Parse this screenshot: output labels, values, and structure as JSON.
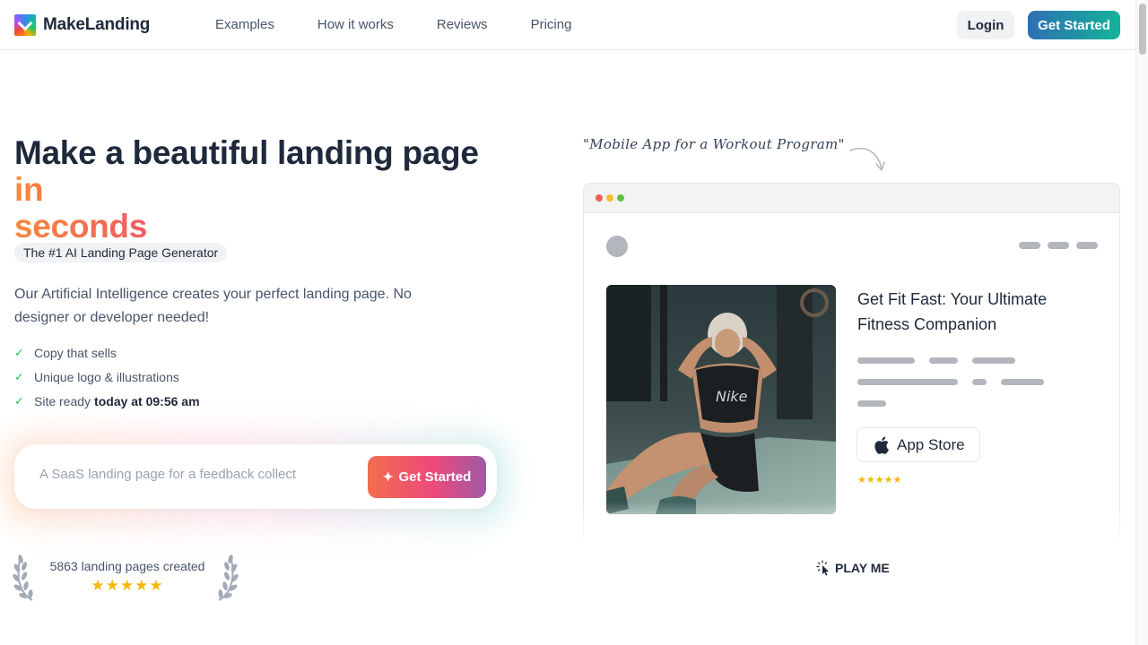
{
  "header": {
    "brand": "MakeLanding",
    "nav": [
      {
        "label": "Examples"
      },
      {
        "label": "How it works"
      },
      {
        "label": "Reviews"
      },
      {
        "label": "Pricing"
      }
    ],
    "login_label": "Login",
    "cta_label": "Get Started"
  },
  "hero": {
    "title_line1": "Make a beautiful landing page",
    "title_line2": "in seconds",
    "badge": "The #1 AI Landing Page Generator",
    "description": "Our Artificial Intelligence creates your perfect landing page. No designer or developer needed!",
    "features": [
      {
        "text": "Copy that sells",
        "bold": ""
      },
      {
        "text": "Unique logo & illustrations",
        "bold": ""
      },
      {
        "text": "Site ready",
        "bold": "today at 09:56 am"
      }
    ],
    "prompt": {
      "placeholder": "A SaaS landing page for a feedback collect",
      "button_label": "Get Started",
      "button_icon": "sparkles-icon"
    },
    "social_proof": {
      "count_text": "5863 landing pages created",
      "stars": "★★★★★",
      "rating": 5
    }
  },
  "preview": {
    "handwritten_note": "\"Mobile App for a Workout Program\"",
    "mock_title": "Get Fit Fast: Your Ultimate Fitness Companion",
    "app_store_label": "App Store",
    "stars": "★★★★★",
    "rating": 5,
    "play_label": "PLAY ME"
  },
  "colors": {
    "brand_gradient_start": "#2f6fb3",
    "brand_gradient_end": "#14b39a",
    "accent_orange": "#f7893a",
    "accent_pink": "#ef4f6b",
    "star": "#f3b90c",
    "check": "#22c55e"
  }
}
